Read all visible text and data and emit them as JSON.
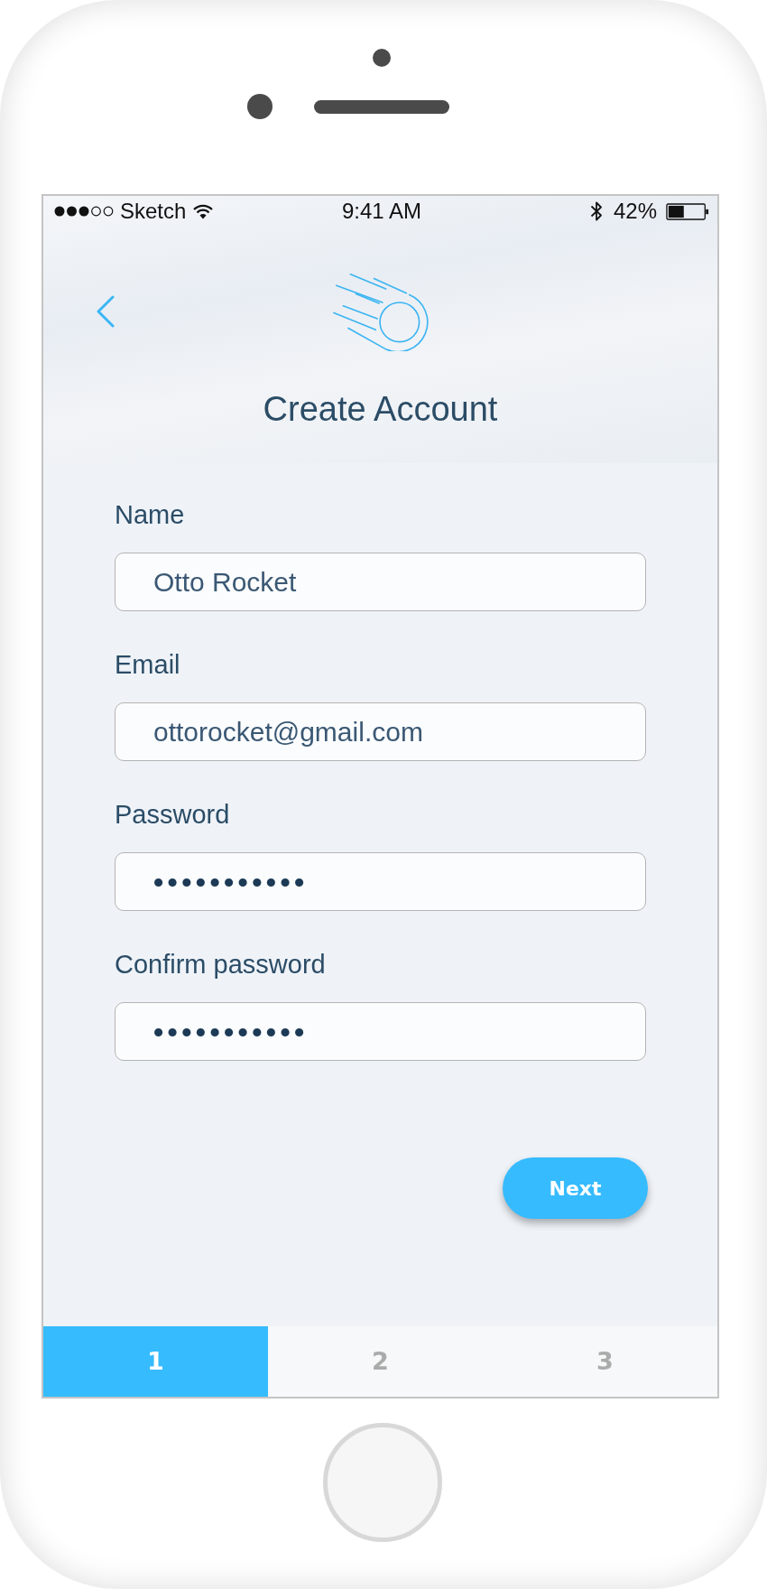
{
  "status_bar": {
    "carrier": "Sketch",
    "time": "9:41 AM",
    "battery": "42%"
  },
  "header": {
    "title": "Create Account"
  },
  "form": {
    "fields": [
      {
        "kind": "text",
        "label": "Name",
        "value": "Otto Rocket"
      },
      {
        "kind": "text",
        "label": "Email",
        "value": "ottorocket@gmail.com"
      },
      {
        "kind": "password",
        "label": "Password",
        "value": "•••••••••••"
      },
      {
        "kind": "password",
        "label": "Confirm password",
        "value": "•••••••••••"
      }
    ]
  },
  "next_button": {
    "label": "Next"
  },
  "steps": [
    {
      "label": "1",
      "selected": true
    },
    {
      "label": "2",
      "selected": false
    },
    {
      "label": "3",
      "selected": false
    }
  ]
}
